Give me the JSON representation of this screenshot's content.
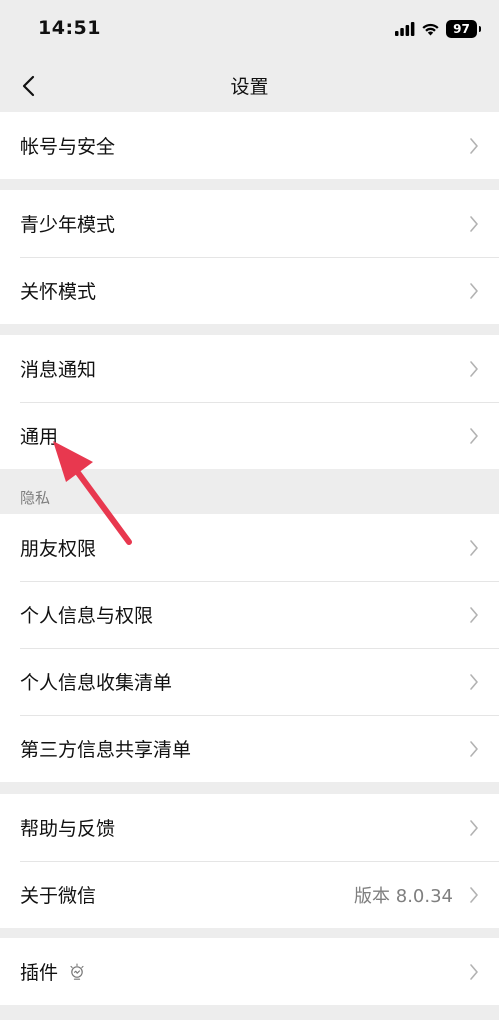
{
  "status_bar": {
    "time": "14:51",
    "battery": "97"
  },
  "nav": {
    "title": "设置"
  },
  "groups": [
    {
      "items": [
        {
          "label": "帐号与安全"
        }
      ]
    },
    {
      "items": [
        {
          "label": "青少年模式"
        },
        {
          "label": "关怀模式"
        }
      ]
    },
    {
      "items": [
        {
          "label": "消息通知"
        },
        {
          "label": "通用"
        }
      ]
    },
    {
      "header": "隐私",
      "items": [
        {
          "label": "朋友权限"
        },
        {
          "label": "个人信息与权限"
        },
        {
          "label": "个人信息收集清单"
        },
        {
          "label": "第三方信息共享清单"
        }
      ]
    },
    {
      "items": [
        {
          "label": "帮助与反馈"
        },
        {
          "label": "关于微信",
          "value": "版本 8.0.34"
        }
      ]
    },
    {
      "items": [
        {
          "label": "插件"
        }
      ]
    }
  ],
  "annotation_color": "#e8384f"
}
